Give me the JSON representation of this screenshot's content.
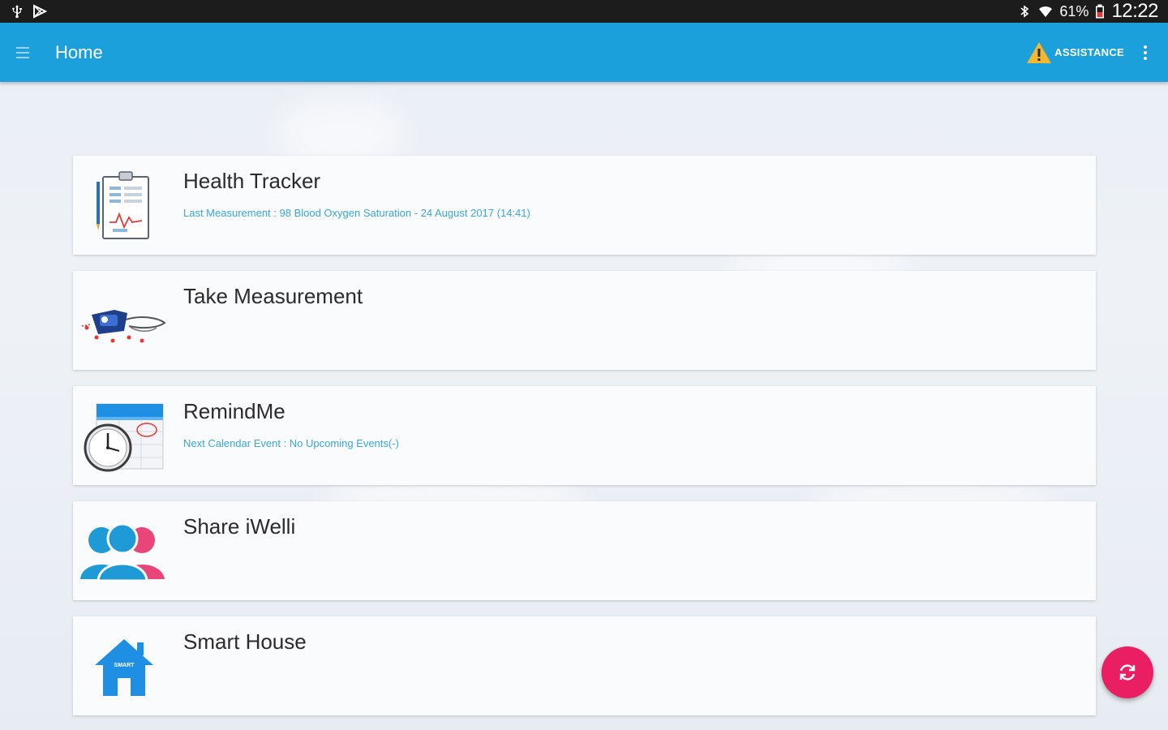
{
  "status_bar": {
    "battery": "61%",
    "time": "12:22"
  },
  "app_bar": {
    "title": "Home",
    "assistance_label": "ASSISTANCE"
  },
  "cards": [
    {
      "title": "Health Tracker",
      "subtitle": "Last Measurement : 98 Blood Oxygen Saturation - 24 August 2017 (14:41)",
      "icon": "clipboard-chart-icon"
    },
    {
      "title": "Take Measurement",
      "subtitle": "",
      "icon": "blood-pressure-monitor-icon"
    },
    {
      "title": "RemindMe",
      "subtitle": "Next Calendar Event : No Upcoming Events(-)",
      "icon": "calendar-clock-icon"
    },
    {
      "title": "Share iWelli",
      "subtitle": "",
      "icon": "people-share-icon"
    },
    {
      "title": "Smart House",
      "subtitle": "",
      "icon": "smart-house-icon",
      "icon_text": "SMART"
    }
  ],
  "colors": {
    "app_bar": "#1ba0db",
    "status_bar": "#1c1c1c",
    "accent_text": "#39a6dc",
    "fab": "#e91e63",
    "warning": "#f5b82e"
  }
}
